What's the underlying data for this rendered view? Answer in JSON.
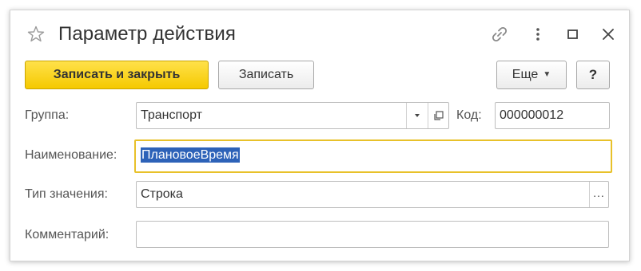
{
  "window": {
    "title": "Параметр действия",
    "icons": [
      "star-icon",
      "link-icon",
      "more-vertical-icon",
      "maximize-icon",
      "close-icon"
    ]
  },
  "toolbar": {
    "save_close_label": "Записать и закрыть",
    "save_label": "Записать",
    "more_label": "Еще",
    "help_label": "?"
  },
  "form": {
    "group": {
      "label": "Группа:",
      "value": "Транспорт"
    },
    "code": {
      "label": "Код:",
      "value": "000000012"
    },
    "name": {
      "label": "Наименование:",
      "value": "ПлановоеВремя"
    },
    "value_type": {
      "label": "Тип значения:",
      "value": "Строка"
    },
    "comment": {
      "label": "Комментарий:",
      "value": ""
    }
  },
  "colors": {
    "primary_button": "#f5c900",
    "focus_border": "#e8c12a",
    "selection": "#2d62b8"
  }
}
